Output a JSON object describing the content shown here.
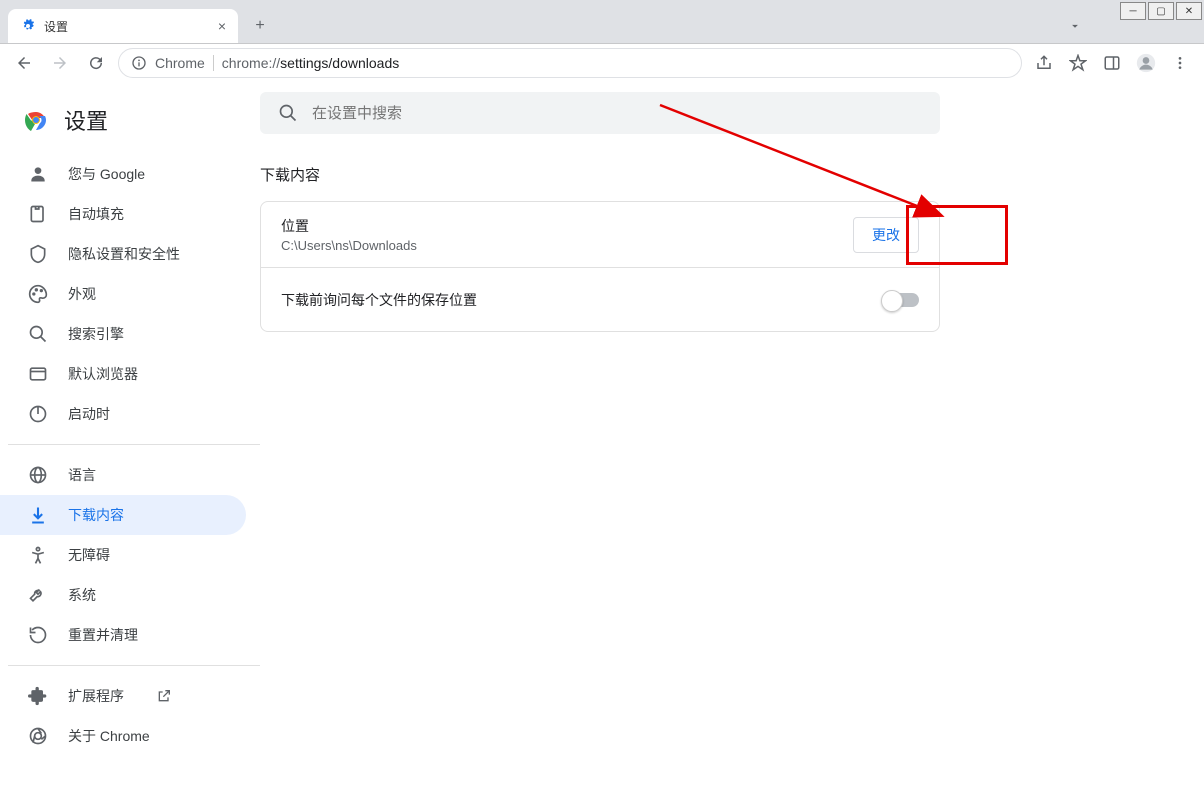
{
  "window": {
    "tab_title": "设置"
  },
  "addressbar": {
    "prefix": "Chrome",
    "url_host": "chrome://",
    "url_path": "settings/downloads"
  },
  "app": {
    "title": "设置",
    "search_placeholder": "在设置中搜索"
  },
  "sidebar": {
    "items": [
      {
        "label": "您与 Google"
      },
      {
        "label": "自动填充"
      },
      {
        "label": "隐私设置和安全性"
      },
      {
        "label": "外观"
      },
      {
        "label": "搜索引擎"
      },
      {
        "label": "默认浏览器"
      },
      {
        "label": "启动时"
      }
    ],
    "items2": [
      {
        "label": "语言"
      },
      {
        "label": "下载内容"
      },
      {
        "label": "无障碍"
      },
      {
        "label": "系统"
      },
      {
        "label": "重置并清理"
      }
    ],
    "items3": [
      {
        "label": "扩展程序"
      },
      {
        "label": "关于 Chrome"
      }
    ]
  },
  "main": {
    "section_title": "下载内容",
    "location_label": "位置",
    "location_path": "C:\\Users\\ns\\Downloads",
    "change_button": "更改",
    "ask_before_label": "下载前询问每个文件的保存位置"
  }
}
